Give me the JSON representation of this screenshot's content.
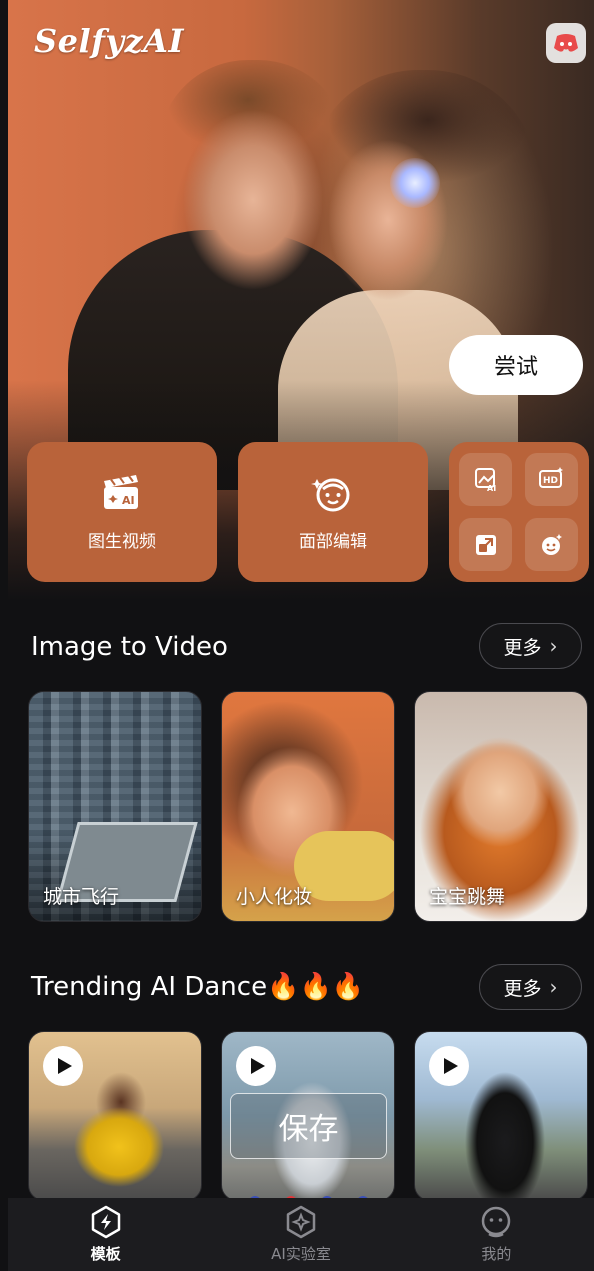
{
  "app": {
    "brand": "SelfyzAI"
  },
  "hero": {
    "try_button": "尝试"
  },
  "features": [
    {
      "label": "图生视频",
      "icon": "clapper-ai-icon"
    },
    {
      "label": "面部编辑",
      "icon": "face-edit-icon"
    }
  ],
  "feature_grid": [
    {
      "icon": "image-ai-icon"
    },
    {
      "icon": "hd-enhance-icon"
    },
    {
      "icon": "expand-image-icon"
    },
    {
      "icon": "face-swap-icon"
    }
  ],
  "sections": {
    "image_to_video": {
      "title": "Image to Video",
      "more": "更多",
      "cards": [
        {
          "caption": "城市飞行"
        },
        {
          "caption": "小人化妆"
        },
        {
          "caption": "宝宝跳舞"
        }
      ]
    },
    "trending_dance": {
      "title": "Trending AI Dance🔥🔥🔥",
      "more": "更多"
    }
  },
  "overlay": {
    "save": "保存"
  },
  "pager_dots": [
    "#3b4fb8",
    "#e0363a",
    "#3b4fb8",
    "#3b4fb8"
  ],
  "bottom_nav": [
    {
      "label": "模板",
      "icon": "template-icon",
      "active": true
    },
    {
      "label": "AI实验室",
      "icon": "ai-lab-icon",
      "active": false
    },
    {
      "label": "我的",
      "icon": "profile-icon",
      "active": false
    }
  ],
  "colors": {
    "accent": "#b9633a",
    "background": "#111113"
  }
}
